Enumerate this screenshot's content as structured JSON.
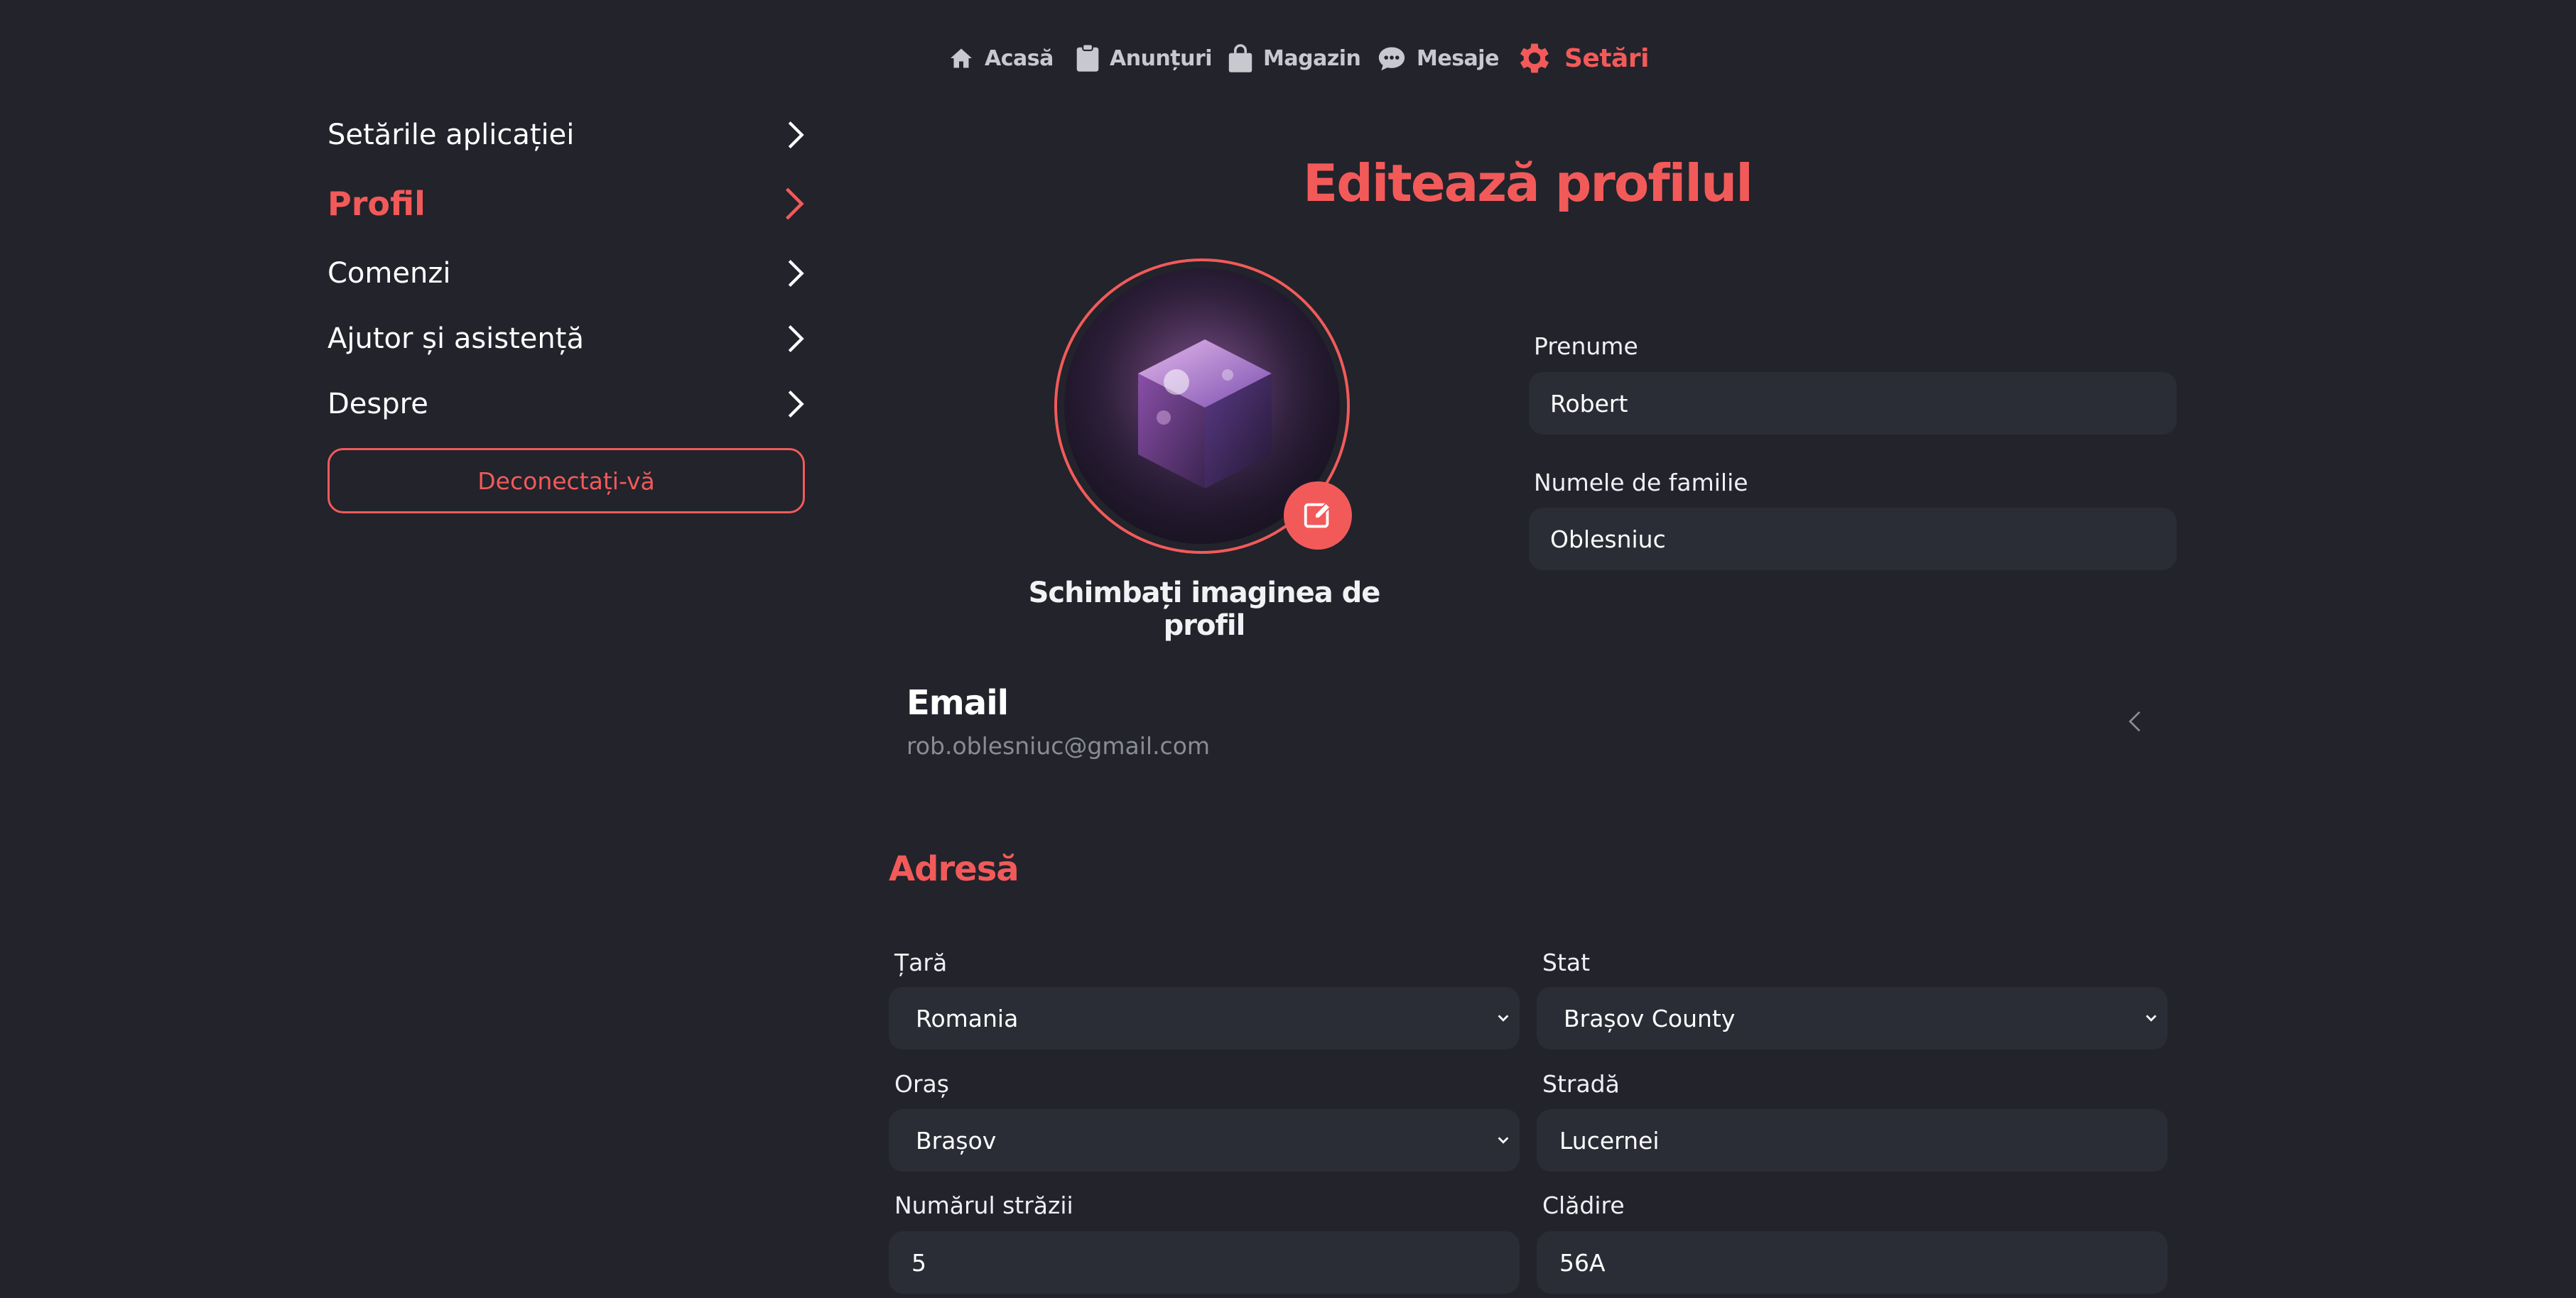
{
  "nav": {
    "items": [
      {
        "label": "Acasă",
        "icon": "home-icon"
      },
      {
        "label": "Anunțuri",
        "icon": "clipboard-icon"
      },
      {
        "label": "Magazin",
        "icon": "shopping-bag-icon"
      },
      {
        "label": "Mesaje",
        "icon": "chat-icon"
      },
      {
        "label": "Setări",
        "icon": "gear-icon",
        "active": true
      }
    ]
  },
  "sidebar": {
    "items": [
      {
        "label": "Setările aplicației"
      },
      {
        "label": "Profil",
        "active": true
      },
      {
        "label": "Comenzi"
      },
      {
        "label": "Ajutor și asistență"
      },
      {
        "label": "Despre"
      }
    ],
    "logout_label": "Deconectați-vă"
  },
  "profile": {
    "title": "Editează profilul",
    "avatar_caption": "Schimbați imaginea de profil",
    "first_name_label": "Prenume",
    "first_name": "Robert",
    "last_name_label": "Numele de familie",
    "last_name": "Oblesniuc"
  },
  "email": {
    "label": "Email",
    "value": "rob.oblesniuc@gmail.com"
  },
  "address": {
    "title": "Adresă",
    "country_label": "Țară",
    "country": "Romania",
    "state_label": "Stat",
    "state": "Brașov County",
    "city_label": "Oraș",
    "city": "Brașov",
    "street_label": "Stradă",
    "street": "Lucernei",
    "street_number_label": "Numărul străzii",
    "street_number": "5",
    "building_label": "Clădire",
    "building": "56A"
  },
  "colors": {
    "accent": "#f25a5a",
    "background": "#22232b",
    "field": "#2b2d36"
  }
}
